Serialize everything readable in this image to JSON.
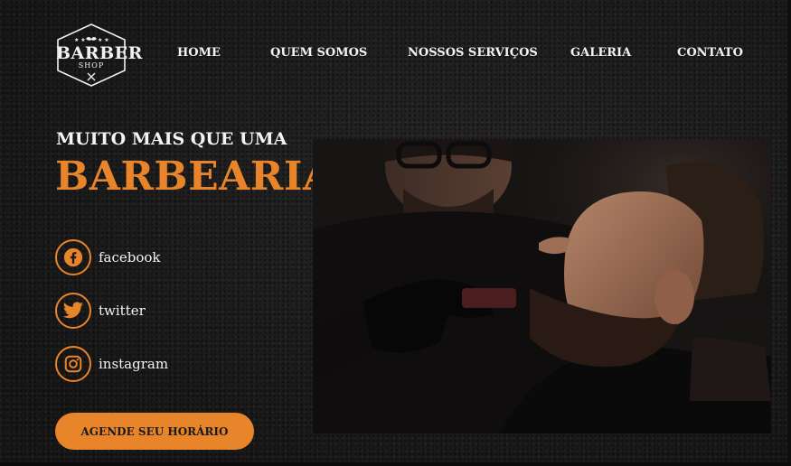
{
  "logo": {
    "line1": "BARBER",
    "line2": "SHOP"
  },
  "nav": {
    "items": [
      {
        "label": "HOME"
      },
      {
        "label": "QUEM SOMOS"
      },
      {
        "label": "NOSSOS SERVIÇOS"
      },
      {
        "label": "GALERIA"
      },
      {
        "label": "CONTATO"
      }
    ]
  },
  "hero": {
    "tagline": "MUITO MAIS QUE UMA",
    "headline": "BARBEARIA"
  },
  "social": [
    {
      "label": "facebook",
      "icon": "facebook-icon"
    },
    {
      "label": "twitter",
      "icon": "twitter-icon"
    },
    {
      "label": "instagram",
      "icon": "instagram-icon"
    }
  ],
  "cta": {
    "label": "AGENDE SEU HORÁRIO"
  },
  "colors": {
    "accent": "#e8842a",
    "background": "#1c1b1b",
    "text": "#f4f4f4"
  }
}
